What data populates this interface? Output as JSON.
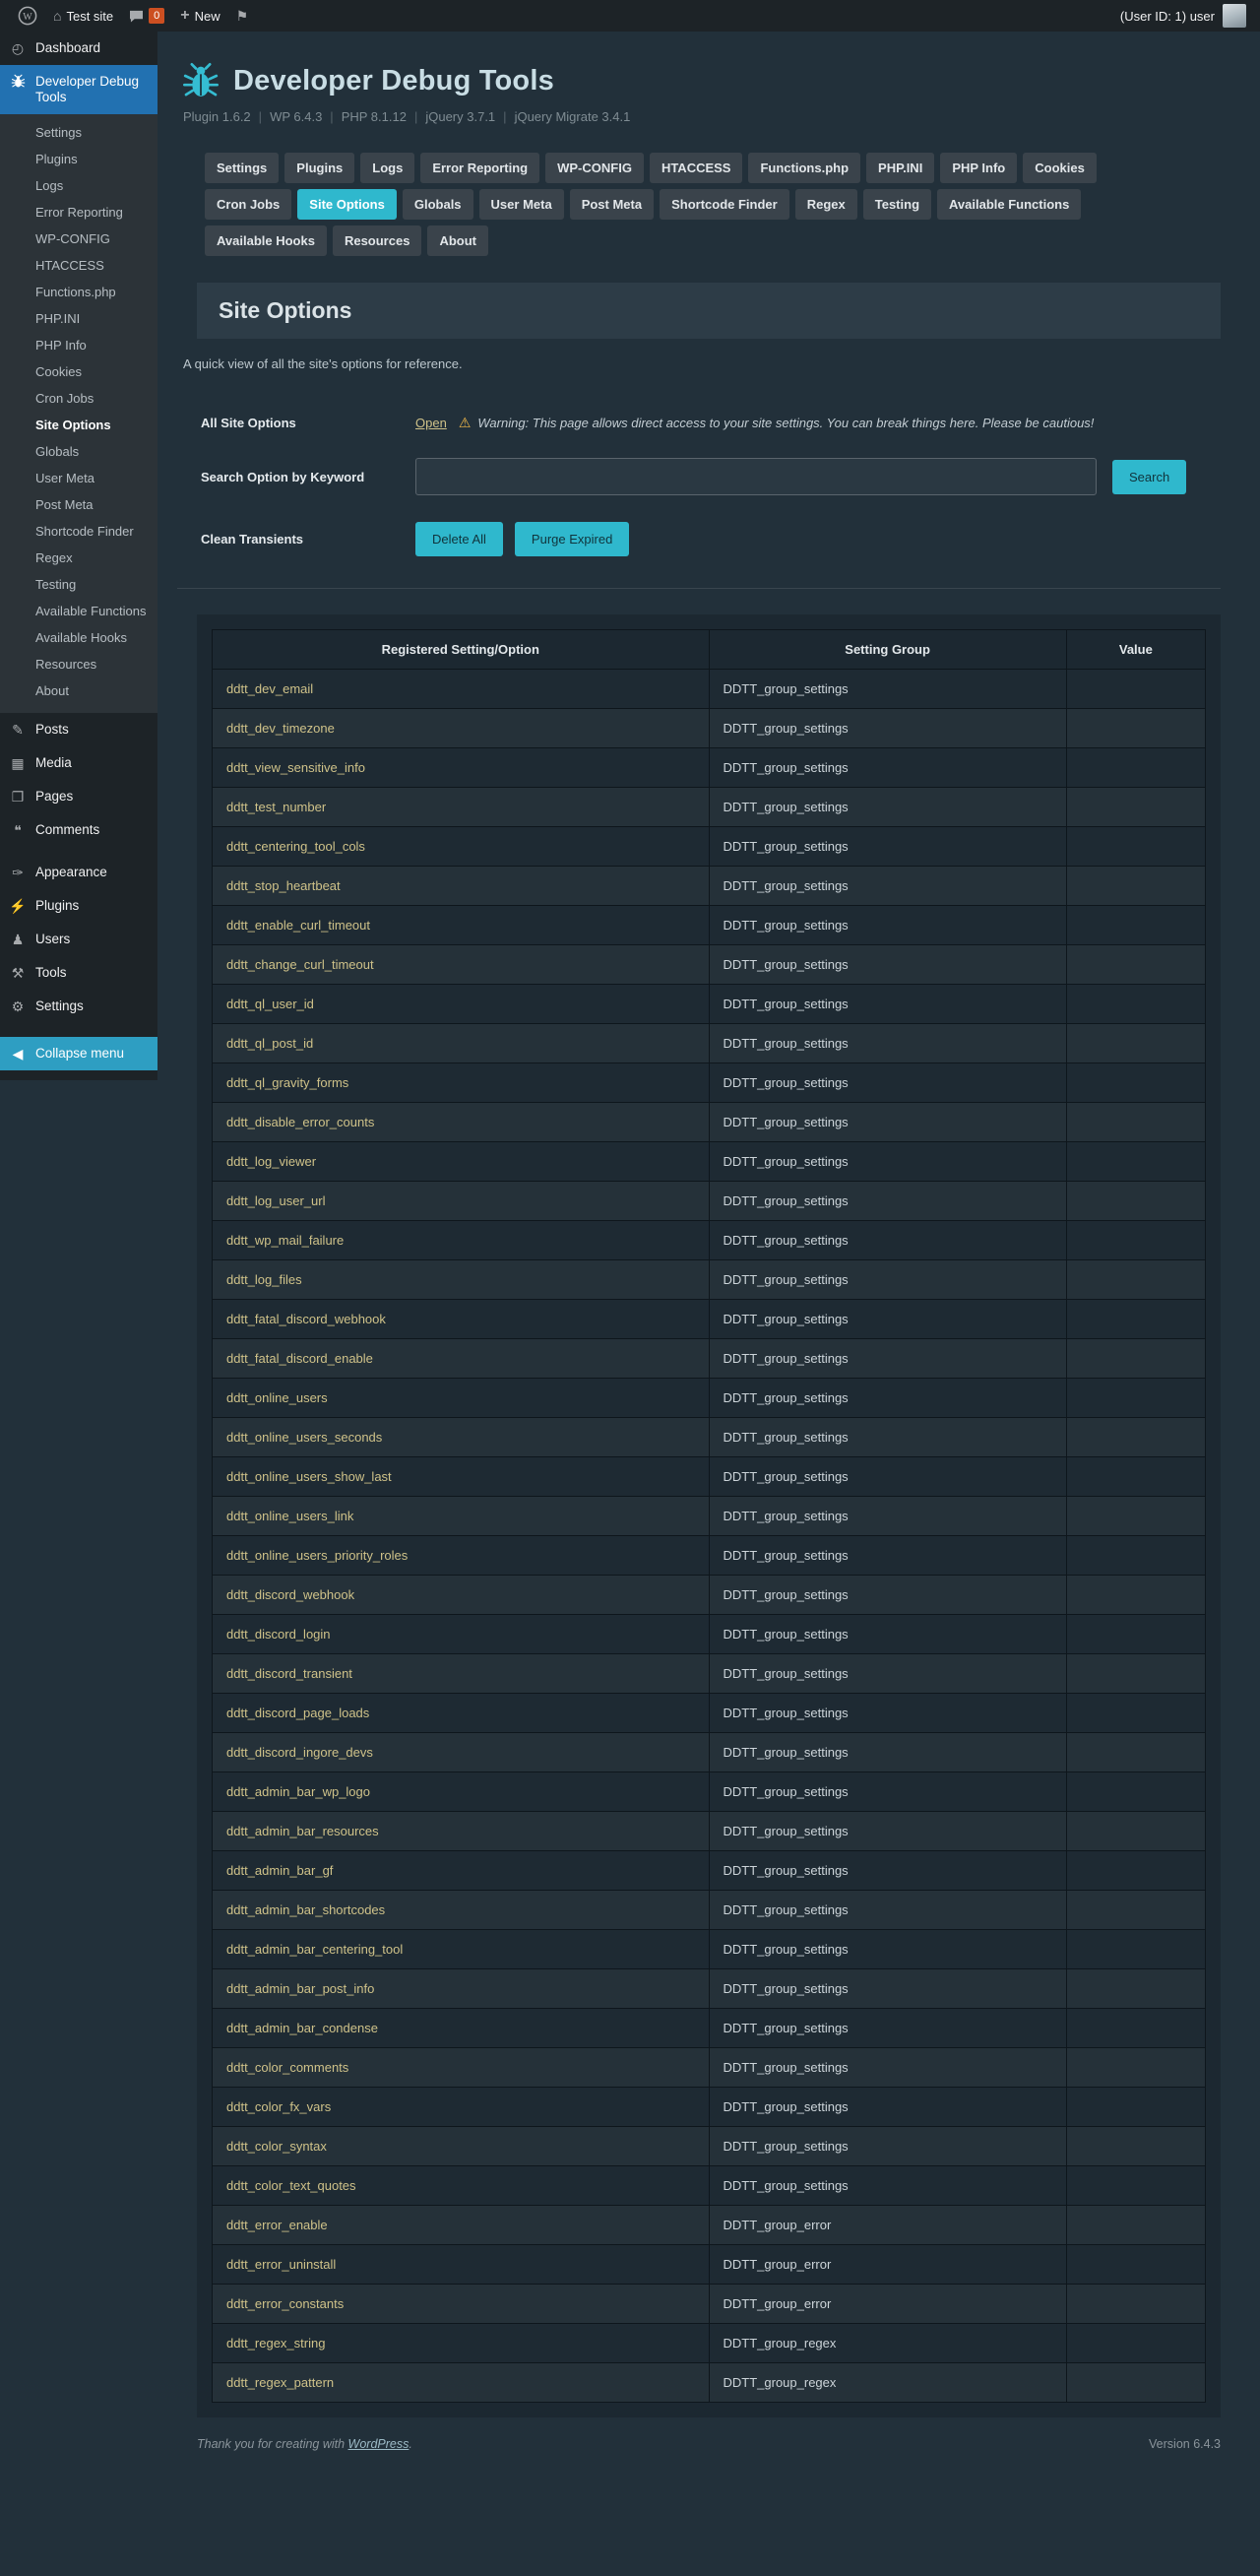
{
  "colors": {
    "accent": "#2fb8cd",
    "link": "#cfc289",
    "menu_highlight": "#2271b1",
    "collapse_highlight": "#2e9ec2",
    "badge": "#cc4f21",
    "warning": "#f0b849"
  },
  "admin_bar": {
    "site_name": "Test site",
    "comments_badge": "0",
    "new_label": "New",
    "user_info": "(User ID: 1) user"
  },
  "sidebar": {
    "dashboard_label": "Dashboard",
    "plugin_menu_label": "Developer Debug Tools",
    "submenu": {
      "active": "Site Options",
      "items": [
        "Settings",
        "Plugins",
        "Logs",
        "Error Reporting",
        "WP-CONFIG",
        "HTACCESS",
        "Functions.php",
        "PHP.INI",
        "PHP Info",
        "Cookies",
        "Cron Jobs",
        "Site Options",
        "Globals",
        "User Meta",
        "Post Meta",
        "Shortcode Finder",
        "Regex",
        "Testing",
        "Available Functions",
        "Available Hooks",
        "Resources",
        "About"
      ]
    },
    "menu_items": [
      {
        "label": "Posts",
        "icon": "pushpin-icon"
      },
      {
        "label": "Media",
        "icon": "media-icon"
      },
      {
        "label": "Pages",
        "icon": "pages-icon"
      },
      {
        "label": "Comments",
        "icon": "comments-icon"
      },
      {
        "label": "Appearance",
        "icon": "appearance-icon",
        "separator_before": true
      },
      {
        "label": "Plugins",
        "icon": "plugin-icon"
      },
      {
        "label": "Users",
        "icon": "users-icon"
      },
      {
        "label": "Tools",
        "icon": "tools-icon"
      },
      {
        "label": "Settings",
        "icon": "settings-icon"
      }
    ],
    "collapse_label": "Collapse menu"
  },
  "header": {
    "title": "Developer Debug Tools",
    "meta": [
      "Plugin 1.6.2",
      "WP 6.4.3",
      "PHP 8.1.12",
      "jQuery 3.7.1",
      "jQuery Migrate 3.4.1"
    ]
  },
  "tabs": {
    "active": "Site Options",
    "items": [
      "Settings",
      "Plugins",
      "Logs",
      "Error Reporting",
      "WP-CONFIG",
      "HTACCESS",
      "Functions.php",
      "PHP.INI",
      "PHP Info",
      "Cookies",
      "Cron Jobs",
      "Site Options",
      "Globals",
      "User Meta",
      "Post Meta",
      "Shortcode Finder",
      "Regex",
      "Testing",
      "Available Functions",
      "Available Hooks",
      "Resources",
      "About"
    ]
  },
  "page": {
    "heading": "Site Options",
    "description": "A quick view of all the site's options for reference.",
    "form": {
      "all_options_label": "All Site Options",
      "open_link": "Open",
      "warning_text": "Warning: This page allows direct access to your site settings. You can break things here. Please be cautious!",
      "search_label": "Search Option by Keyword",
      "search_input": {
        "value": "",
        "placeholder": ""
      },
      "search_button": "Search",
      "transients_label": "Clean Transients",
      "delete_all_button": "Delete All",
      "purge_expired_button": "Purge Expired"
    }
  },
  "table": {
    "headers": [
      "Registered Setting/Option",
      "Setting Group",
      "Value"
    ],
    "rows": [
      {
        "option": "ddtt_dev_email",
        "group": "DDTT_group_settings",
        "value": ""
      },
      {
        "option": "ddtt_dev_timezone",
        "group": "DDTT_group_settings",
        "value": ""
      },
      {
        "option": "ddtt_view_sensitive_info",
        "group": "DDTT_group_settings",
        "value": ""
      },
      {
        "option": "ddtt_test_number",
        "group": "DDTT_group_settings",
        "value": ""
      },
      {
        "option": "ddtt_centering_tool_cols",
        "group": "DDTT_group_settings",
        "value": ""
      },
      {
        "option": "ddtt_stop_heartbeat",
        "group": "DDTT_group_settings",
        "value": ""
      },
      {
        "option": "ddtt_enable_curl_timeout",
        "group": "DDTT_group_settings",
        "value": ""
      },
      {
        "option": "ddtt_change_curl_timeout",
        "group": "DDTT_group_settings",
        "value": ""
      },
      {
        "option": "ddtt_ql_user_id",
        "group": "DDTT_group_settings",
        "value": ""
      },
      {
        "option": "ddtt_ql_post_id",
        "group": "DDTT_group_settings",
        "value": ""
      },
      {
        "option": "ddtt_ql_gravity_forms",
        "group": "DDTT_group_settings",
        "value": ""
      },
      {
        "option": "ddtt_disable_error_counts",
        "group": "DDTT_group_settings",
        "value": ""
      },
      {
        "option": "ddtt_log_viewer",
        "group": "DDTT_group_settings",
        "value": ""
      },
      {
        "option": "ddtt_log_user_url",
        "group": "DDTT_group_settings",
        "value": ""
      },
      {
        "option": "ddtt_wp_mail_failure",
        "group": "DDTT_group_settings",
        "value": ""
      },
      {
        "option": "ddtt_log_files",
        "group": "DDTT_group_settings",
        "value": ""
      },
      {
        "option": "ddtt_fatal_discord_webhook",
        "group": "DDTT_group_settings",
        "value": ""
      },
      {
        "option": "ddtt_fatal_discord_enable",
        "group": "DDTT_group_settings",
        "value": ""
      },
      {
        "option": "ddtt_online_users",
        "group": "DDTT_group_settings",
        "value": ""
      },
      {
        "option": "ddtt_online_users_seconds",
        "group": "DDTT_group_settings",
        "value": ""
      },
      {
        "option": "ddtt_online_users_show_last",
        "group": "DDTT_group_settings",
        "value": ""
      },
      {
        "option": "ddtt_online_users_link",
        "group": "DDTT_group_settings",
        "value": ""
      },
      {
        "option": "ddtt_online_users_priority_roles",
        "group": "DDTT_group_settings",
        "value": ""
      },
      {
        "option": "ddtt_discord_webhook",
        "group": "DDTT_group_settings",
        "value": ""
      },
      {
        "option": "ddtt_discord_login",
        "group": "DDTT_group_settings",
        "value": ""
      },
      {
        "option": "ddtt_discord_transient",
        "group": "DDTT_group_settings",
        "value": ""
      },
      {
        "option": "ddtt_discord_page_loads",
        "group": "DDTT_group_settings",
        "value": ""
      },
      {
        "option": "ddtt_discord_ingore_devs",
        "group": "DDTT_group_settings",
        "value": ""
      },
      {
        "option": "ddtt_admin_bar_wp_logo",
        "group": "DDTT_group_settings",
        "value": ""
      },
      {
        "option": "ddtt_admin_bar_resources",
        "group": "DDTT_group_settings",
        "value": ""
      },
      {
        "option": "ddtt_admin_bar_gf",
        "group": "DDTT_group_settings",
        "value": ""
      },
      {
        "option": "ddtt_admin_bar_shortcodes",
        "group": "DDTT_group_settings",
        "value": ""
      },
      {
        "option": "ddtt_admin_bar_centering_tool",
        "group": "DDTT_group_settings",
        "value": ""
      },
      {
        "option": "ddtt_admin_bar_post_info",
        "group": "DDTT_group_settings",
        "value": ""
      },
      {
        "option": "ddtt_admin_bar_condense",
        "group": "DDTT_group_settings",
        "value": ""
      },
      {
        "option": "ddtt_color_comments",
        "group": "DDTT_group_settings",
        "value": ""
      },
      {
        "option": "ddtt_color_fx_vars",
        "group": "DDTT_group_settings",
        "value": ""
      },
      {
        "option": "ddtt_color_syntax",
        "group": "DDTT_group_settings",
        "value": ""
      },
      {
        "option": "ddtt_color_text_quotes",
        "group": "DDTT_group_settings",
        "value": ""
      },
      {
        "option": "ddtt_error_enable",
        "group": "DDTT_group_error",
        "value": ""
      },
      {
        "option": "ddtt_error_uninstall",
        "group": "DDTT_group_error",
        "value": ""
      },
      {
        "option": "ddtt_error_constants",
        "group": "DDTT_group_error",
        "value": ""
      },
      {
        "option": "ddtt_regex_string",
        "group": "DDTT_group_regex",
        "value": ""
      },
      {
        "option": "ddtt_regex_pattern",
        "group": "DDTT_group_regex",
        "value": ""
      }
    ]
  },
  "footer": {
    "thanks_prefix": "Thank you for creating with ",
    "wordpress_link": "WordPress",
    "thanks_suffix": ".",
    "version": "Version 6.4.3"
  }
}
